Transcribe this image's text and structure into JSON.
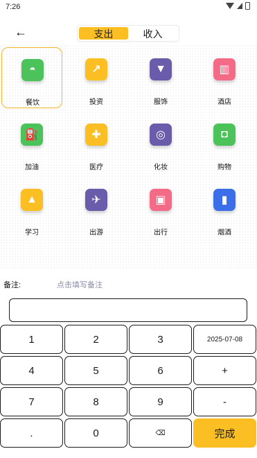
{
  "status_bar": {
    "time": "7:26"
  },
  "header": {
    "back_icon": "back-arrow-icon",
    "tabs": [
      {
        "label": "支出",
        "active": true
      },
      {
        "label": "收入",
        "active": false
      }
    ]
  },
  "categories": [
    {
      "label": "餐饮",
      "icon": "dining-icon",
      "glyph": "◓",
      "color": "#4cc35a",
      "selected": true
    },
    {
      "label": "投资",
      "icon": "investment-icon",
      "glyph": "↗",
      "color": "#fbbf24",
      "selected": false
    },
    {
      "label": "服饰",
      "icon": "clothing-icon",
      "glyph": "▼",
      "color": "#6b5bab",
      "selected": false
    },
    {
      "label": "酒店",
      "icon": "hotel-icon",
      "glyph": "▥",
      "color": "#f36b86",
      "selected": false
    },
    {
      "label": "加油",
      "icon": "fuel-icon",
      "glyph": "⛽",
      "color": "#4cc35a",
      "selected": false
    },
    {
      "label": "医疗",
      "icon": "medical-icon",
      "glyph": "✚",
      "color": "#fbbf24",
      "selected": false
    },
    {
      "label": "化妆",
      "icon": "cosmetics-icon",
      "glyph": "◎",
      "color": "#6b5bab",
      "selected": false
    },
    {
      "label": "购物",
      "icon": "shopping-icon",
      "glyph": "◘",
      "color": "#4cc35a",
      "selected": false
    },
    {
      "label": "学习",
      "icon": "study-icon",
      "glyph": "▲",
      "color": "#fbbf24",
      "selected": false
    },
    {
      "label": "出游",
      "icon": "travel-icon",
      "glyph": "✈",
      "color": "#6b5bab",
      "selected": false
    },
    {
      "label": "出行",
      "icon": "bus-icon",
      "glyph": "▣",
      "color": "#f36b86",
      "selected": false
    },
    {
      "label": "烟酒",
      "icon": "tobacco-alcohol-icon",
      "glyph": "▮",
      "color": "#3b6ee8",
      "selected": false
    }
  ],
  "remark": {
    "label": "备注:",
    "hint": "点击填写备注",
    "value": ""
  },
  "keypad": [
    "1",
    "2",
    "3",
    "2025-07-08",
    "4",
    "5",
    "6",
    "+",
    "7",
    "8",
    "9",
    "-",
    ".",
    "0",
    "⌫",
    "完成"
  ],
  "colors": {
    "accent": "#fbbf24",
    "selected_border": "#f5b52a"
  }
}
